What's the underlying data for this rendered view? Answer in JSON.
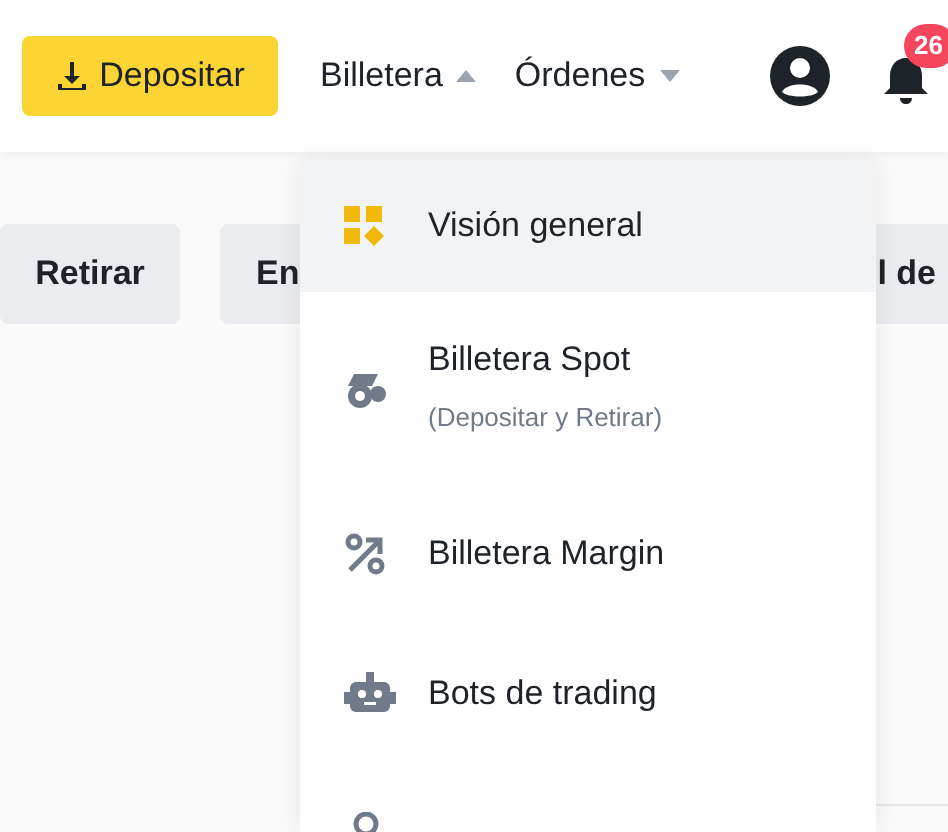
{
  "header": {
    "deposit_button": "Depositar",
    "menus": [
      {
        "label": "Billetera",
        "expanded": true
      },
      {
        "label": "Órdenes",
        "expanded": false
      }
    ],
    "notifications_badge": "26"
  },
  "actions": [
    "Retirar",
    "En",
    "l de"
  ],
  "dropdown": {
    "items": [
      {
        "kind": "overview",
        "label": "Visión general",
        "selected": true
      },
      {
        "kind": "spot",
        "label": "Billetera Spot",
        "sublabel": "(Depositar y Retirar)",
        "selected": false
      },
      {
        "kind": "margin",
        "label": "Billetera Margin",
        "selected": false
      },
      {
        "kind": "bots",
        "label": "Bots de trading",
        "selected": false
      },
      {
        "kind": "earn",
        "selected": false
      }
    ]
  }
}
